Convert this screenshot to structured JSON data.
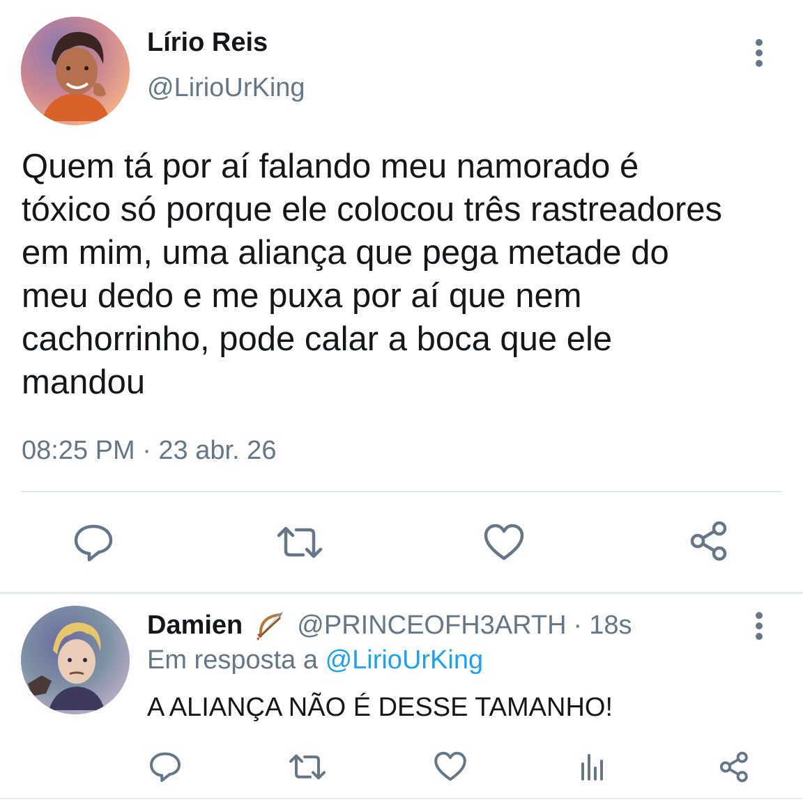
{
  "main_tweet": {
    "author_name": "Lírio Reis",
    "author_handle": "@LirioUrKing",
    "text_lines": [
      "Quem tá por aí falando meu namorado é",
      "tóxico só porque ele colocou três rastreadores",
      "em mim, uma aliança que pega metade do",
      "meu dedo e me puxa por aí que nem",
      "cachorrinho, pode calar a boca que ele",
      "mandou"
    ],
    "timestamp": "08:25 PM · 23 abr. 26",
    "actions": [
      "reply-icon",
      "retweet-icon",
      "like-icon",
      "share-icon"
    ]
  },
  "reply_tweet": {
    "author_name": "Damien",
    "author_emoji": "bow-and-arrow-emoji",
    "author_handle": "@PRINCEOFH3ARTH",
    "separator": "·",
    "age": "18s",
    "reply_to_prefix": "Em resposta a",
    "reply_to_handle": "@LirioUrKing",
    "text": "A ALIANÇA NÃO É DESSE TAMANHO!",
    "actions": [
      "reply-icon",
      "retweet-icon",
      "like-icon",
      "analytics-icon",
      "share-icon"
    ]
  },
  "colors": {
    "text_primary": "#14171a",
    "text_secondary": "#657786",
    "link": "#1da1f2",
    "icon": "#657786",
    "divider": "#e1e8ed"
  }
}
